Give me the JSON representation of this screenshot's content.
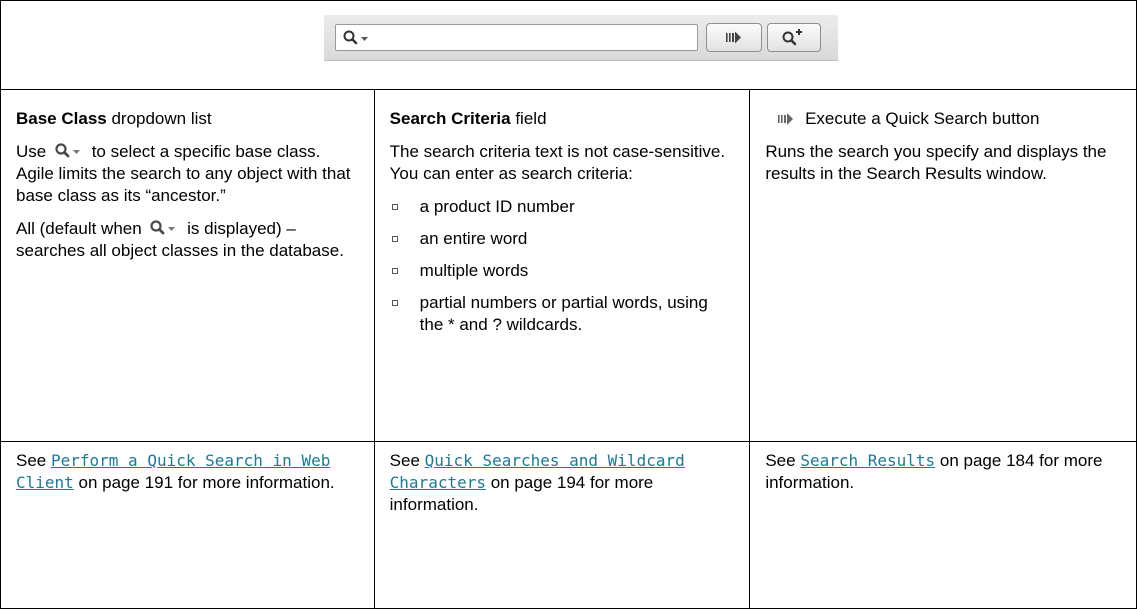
{
  "toolbar": {
    "search_placeholder": "",
    "icons": [
      "magnifier-dropdown-icon",
      "execute-arrow-icon",
      "advanced-search-icon"
    ]
  },
  "columns": [
    {
      "title_bold": "Base Class",
      "title_rest": " dropdown list",
      "p1_before": "Use",
      "p1_after": "to select a specific base class. Agile limits the search to any object with that base class as its “ancestor.”",
      "p2_before": "All (default when",
      "p2_after": "is displayed) – searches all object classes in the database."
    },
    {
      "title_bold": "Search Criteria",
      "title_rest": " field",
      "intro": "The search criteria text is not case-sensitive. You can enter as search criteria:",
      "bullets": [
        "a product ID number",
        "an entire word",
        "multiple words",
        "partial numbers or partial words, using the * and ? wildcards."
      ]
    },
    {
      "title": "Execute a Quick Search button",
      "description": "Runs the search you specify and displays the results in the Search Results window."
    }
  ],
  "see_also": [
    {
      "prefix": "See ",
      "link": "Perform a Quick Search in Web Client",
      "suffix": " on page 191 for more information."
    },
    {
      "prefix": "See ",
      "link": "Quick Searches and Wildcard Characters",
      "suffix": " on page 194 for more information."
    },
    {
      "prefix": "See ",
      "link": "Search Results",
      "suffix": " on page 184 for more information."
    }
  ],
  "colors": {
    "link": "#1a7a9a",
    "border": "#000000"
  }
}
